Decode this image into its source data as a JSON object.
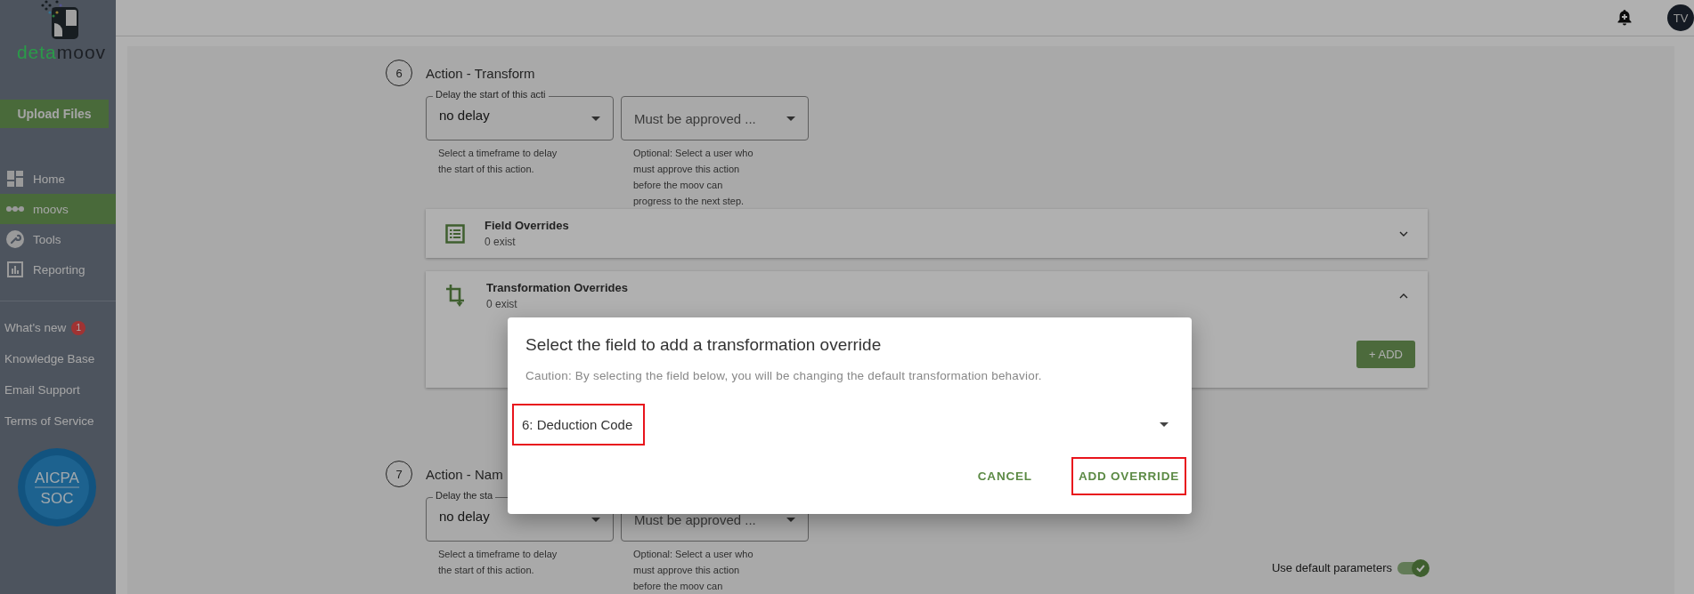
{
  "topbar": {
    "avatar": "TV"
  },
  "sidebar": {
    "logo": {
      "part1": "deta",
      "part2": "moov"
    },
    "upload_button": "Upload Files",
    "nav": [
      {
        "label": "Home",
        "kind": "dashboard",
        "selected": false
      },
      {
        "label": "moovs",
        "kind": "moovs",
        "selected": true
      },
      {
        "label": "Tools",
        "kind": "tools",
        "selected": false
      },
      {
        "label": "Reporting",
        "kind": "reporting",
        "selected": false
      }
    ],
    "links": [
      {
        "label": "What's new",
        "badge": "1"
      },
      {
        "label": "Knowledge Base"
      },
      {
        "label": "Email Support"
      },
      {
        "label": "Terms of Service"
      }
    ],
    "certification": {
      "line1": "AICPA",
      "line2": "SOC"
    }
  },
  "steps": [
    {
      "number": "6",
      "title": "Action - Transform",
      "delay": {
        "label": "Delay the start of this acti",
        "value": "no delay",
        "help": [
          "Select a timeframe to delay",
          "the start of this action."
        ]
      },
      "approver": {
        "placeholder": "Must be approved ...",
        "help": [
          "Optional: Select a user who",
          "must approve this action",
          "before the moov can",
          "progress to the next step."
        ]
      },
      "overrides": [
        {
          "title": "Field Overrides",
          "count": "0 exist",
          "kind": "fields",
          "expanded": false
        },
        {
          "title": "Transformation Overrides",
          "count": "0 exist",
          "kind": "transformations",
          "expanded": true,
          "add_button": "+ ADD"
        }
      ]
    },
    {
      "number": "7",
      "title": "Action - Nam",
      "delay": {
        "label": "Delay the sta",
        "value": "no delay",
        "help": [
          "Select a timeframe to delay",
          "the start of this action."
        ]
      },
      "approver": {
        "placeholder": "Must be approved ...",
        "help": [
          "Optional: Select a user who",
          "must approve this action",
          "before the moov can"
        ]
      },
      "default_params": {
        "label": "Use default parameters",
        "checked": true
      }
    }
  ],
  "dialog": {
    "title": "Select the field to add a transformation override",
    "caution": "Caution: By selecting the field below, you will be changing the default transformation behavior.",
    "select": {
      "value": "6: Deduction Code",
      "highlighted": true
    },
    "buttons": [
      {
        "label": "CANCEL",
        "highlighted": false
      },
      {
        "label": "ADD OVERRIDE",
        "highlighted": true
      }
    ]
  }
}
